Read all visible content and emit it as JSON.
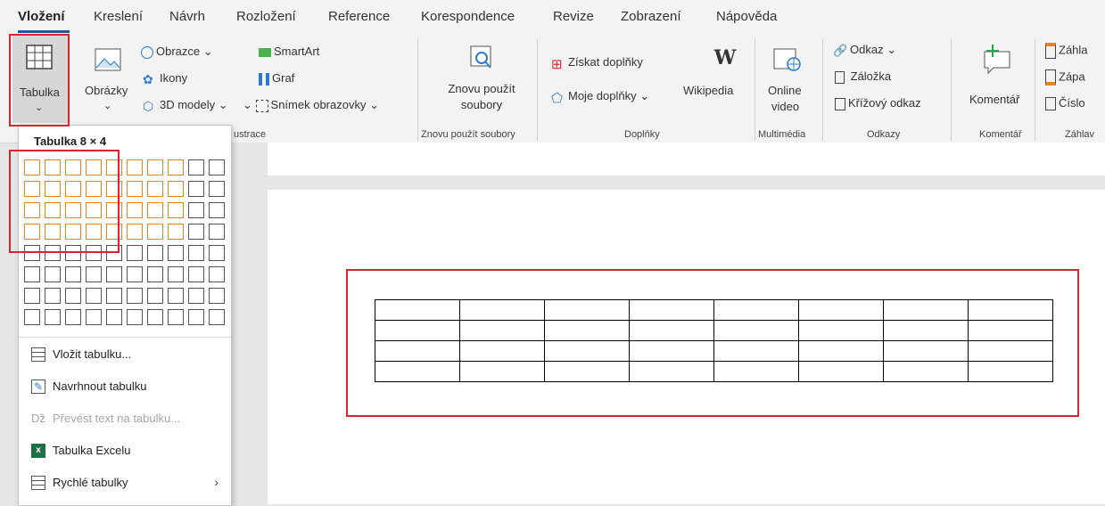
{
  "tabs": [
    "Vložení",
    "Kreslení",
    "Návrh",
    "Rozložení",
    "Reference",
    "Korespondence",
    "Revize",
    "Zobrazení",
    "Nápověda"
  ],
  "ribbon": {
    "tabulka": "Tabulka",
    "obrazky": "Obrázky",
    "obrazce": "Obrazce",
    "ikony": "Ikony",
    "modely3d": "3D modely",
    "smartart": "SmartArt",
    "graf": "Graf",
    "snimek": "Snímek obrazovky",
    "znovu_line1": "Znovu použít",
    "znovu_line2": "soubory",
    "ziskat": "Získat doplňky",
    "moje": "Moje doplňky",
    "wikipedia": "Wikipedia",
    "online1": "Online",
    "online2": "video",
    "odkaz": "Odkaz",
    "zalozka": "Záložka",
    "krizovy": "Křížový odkaz",
    "komentar": "Komentář",
    "zahlavi": "Záhla",
    "zapati": "Zápa",
    "cislo": "Číslo",
    "groups": {
      "ilustrace": "ustrace",
      "znovu": "Znovu použít soubory",
      "doplnky": "Doplňky",
      "multimedia": "Multimédia",
      "odkazy": "Odkazy",
      "komentar": "Komentář",
      "zahlavi": "Záhlav"
    }
  },
  "dropdown": {
    "title": "Tabulka 8 × 4",
    "grid": {
      "cols": 10,
      "rows": 8,
      "selected_cols": 8,
      "selected_rows": 4
    },
    "items": [
      {
        "label": "Vložit tabulku...",
        "enabled": true
      },
      {
        "label": "Navrhnout tabulku",
        "enabled": true
      },
      {
        "label": "Převést text na tabulku...",
        "enabled": false
      },
      {
        "label": "Tabulka Excelu",
        "enabled": true
      },
      {
        "label": "Rychlé tabulky",
        "enabled": true
      }
    ]
  },
  "document_table": {
    "cols": 8,
    "rows": 4
  },
  "colors": {
    "accent": "#2b579a",
    "highlight_border": "#e8841e",
    "annotation_red": "#d9232d"
  }
}
